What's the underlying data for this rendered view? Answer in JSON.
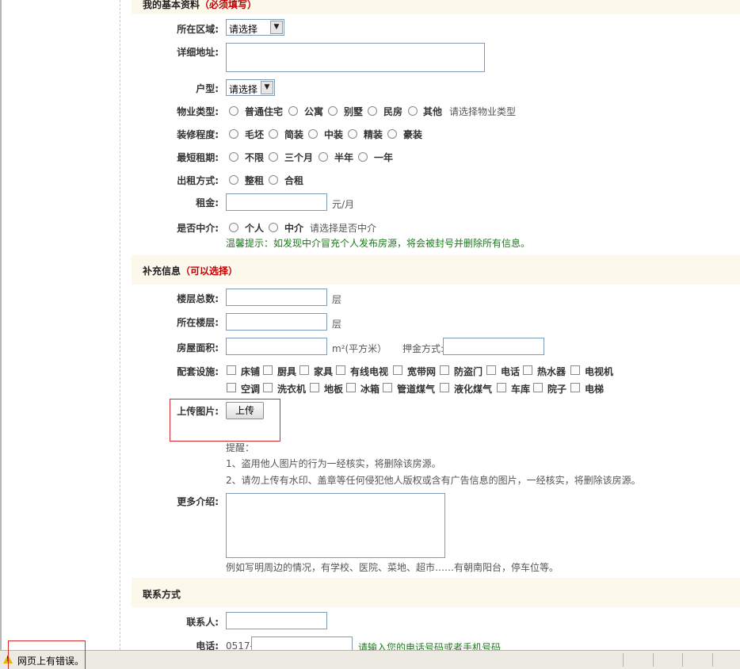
{
  "basic": {
    "title": "我的基本资料",
    "required_note": "（必须填写）",
    "region_label": "所在区域:",
    "region_value": "请选择",
    "address_label": "详细地址:",
    "layout_label": "户型:",
    "layout_value": "请选择",
    "property_label": "物业类型:",
    "property_options": [
      "普通住宅",
      "公寓",
      "别墅",
      "民房",
      "其他"
    ],
    "property_hint": "请选择物业类型",
    "decoration_label": "装修程度:",
    "decoration_options": [
      "毛坯",
      "简装",
      "中装",
      "精装",
      "豪装"
    ],
    "lease_label": "最短租期:",
    "lease_options": [
      "不限",
      "三个月",
      "半年",
      "一年"
    ],
    "rent_type_label": "出租方式:",
    "rent_type_options": [
      "整租",
      "合租"
    ],
    "rent_label": "租金:",
    "rent_unit": "元/月",
    "agent_label": "是否中介:",
    "agent_options": [
      "个人",
      "中介"
    ],
    "agent_hint": "请选择是否中介",
    "agent_warning": "温馨提示：如发现中介冒充个人发布房源，将会被封号并删除所有信息。"
  },
  "extra": {
    "title": "补充信息",
    "optional_note": "（可以选择）",
    "total_floors_label": "楼层总数:",
    "floor_unit": "层",
    "floor_label": "所在楼层:",
    "area_label": "房屋面积:",
    "area_unit": "m²(平方米）",
    "deposit_label": "押金方式:",
    "facilities_label": "配套设施:",
    "facilities_row1": [
      "床铺",
      "厨具",
      "家具",
      "有线电视",
      "宽带网",
      "防盗门",
      "电话",
      "热水器",
      "电视机"
    ],
    "facilities_row2": [
      "空调",
      "洗衣机",
      "地板",
      "冰箱",
      "管道煤气",
      "液化煤气",
      "车库",
      "院子",
      "电梯"
    ],
    "upload_label": "上传图片:",
    "upload_button": "上传",
    "reminder_title": "提醒：",
    "reminder_1": "1、盗用他人图片的行为一经核实，将删除该房源。",
    "reminder_2": "2、请勿上传有水印、盖章等任何侵犯他人版权或含有广告信息的图片，一经核实，将删除该房源。",
    "more_label": "更多介绍:",
    "more_hint": "例如写明周边的情况，有学校、医院、菜地、超市……有朝南阳台，停车位等。"
  },
  "contact": {
    "title": "联系方式",
    "person_label": "联系人:",
    "phone_label": "电话:",
    "phone_prefix": "0517-",
    "phone_hint": "请输入您的电话号码或者手机号码"
  },
  "status": {
    "message": "网页上有错误。"
  }
}
